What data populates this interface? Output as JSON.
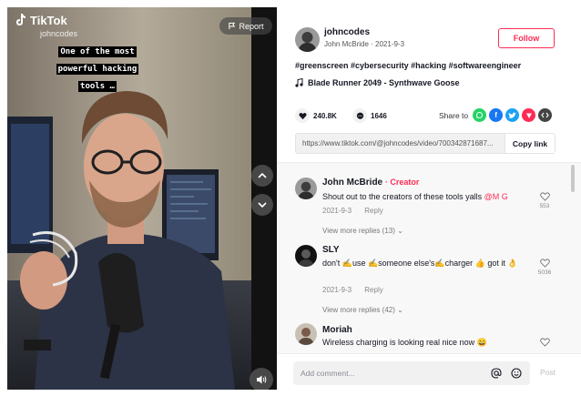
{
  "video": {
    "brand": "TikTok",
    "handle": "johncodes",
    "report_label": "Report",
    "caption": "One of the most powerful hacking tools …",
    "icons": {
      "logo": "tiktok-logo-icon",
      "report": "flag-icon",
      "prev": "chevron-up-icon",
      "next": "chevron-down-icon",
      "sound": "speaker-icon"
    }
  },
  "author": {
    "username": "johncodes",
    "display_name": "John McBride",
    "date": "2021-9-3",
    "meta": "John McBride · 2021-9-3",
    "follow_label": "Follow"
  },
  "description": {
    "hashtags": "#greenscreen #cybersecurity #hacking #softwareengineer",
    "music": "Blade Runner 2049 - Synthwave Goose"
  },
  "stats": {
    "likes": "240.8K",
    "comments": "1646"
  },
  "share": {
    "label": "Share to",
    "targets": [
      "whatsapp-icon",
      "facebook-icon",
      "twitter-icon",
      "pinterest-icon",
      "embed-icon"
    ]
  },
  "link": {
    "url": "https://www.tiktok.com/@johncodes/video/700342871687...",
    "copy_label": "Copy link"
  },
  "comments": [
    {
      "name": "John McBride",
      "badge": "· Creator",
      "text": "Shout out to the creators of these tools yalls ",
      "mention": "@M G",
      "date": "2021-9-3",
      "reply_label": "Reply",
      "likes": "553",
      "more_replies": "View more replies (13)"
    },
    {
      "name": "SLY",
      "text": "don't ✍️use ✍️someone else's✍️charger 👍 got it 👌",
      "date": "2021-9-3",
      "reply_label": "Reply",
      "likes": "5036",
      "more_replies": "View more replies (42)"
    },
    {
      "name": "Moriah",
      "text": "Wireless charging is looking real nice now 😄"
    }
  ],
  "composer": {
    "placeholder": "Add comment...",
    "post_label": "Post",
    "icons": [
      "at-icon",
      "emoji-icon"
    ]
  },
  "colors": {
    "accent": "#fe2c55",
    "text": "#161823",
    "muted": "#888888",
    "whatsapp": "#25d366",
    "facebook": "#1877f2",
    "twitter": "#1da1f2",
    "pinterest": "#fe2c55",
    "embed": "#444444"
  }
}
